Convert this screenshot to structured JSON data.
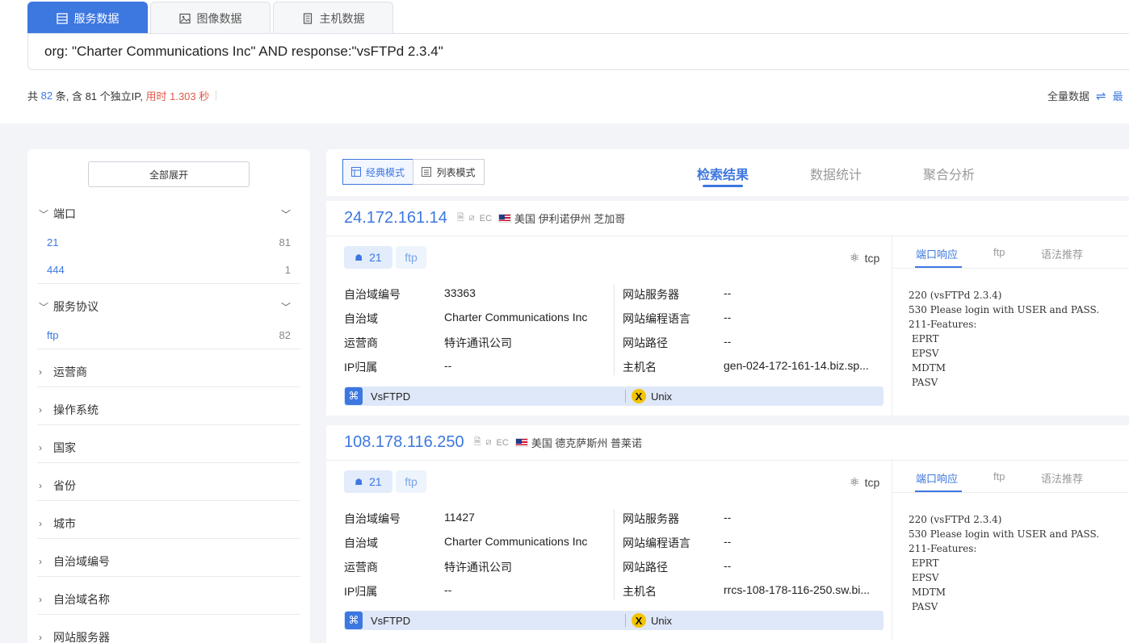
{
  "tabs": [
    {
      "label": "服务数据",
      "icon": "table-icon",
      "active": true
    },
    {
      "label": "图像数据",
      "icon": "image-icon",
      "active": false
    },
    {
      "label": "主机数据",
      "icon": "server-icon",
      "active": false
    }
  ],
  "query": "org: \"Charter Communications Inc\" AND response:\"vsFTPd 2.3.4\"",
  "stats": {
    "prefix": "共",
    "total": "82",
    "mid": "条, 含 81 个独立IP,",
    "time": "用时 1.303 秒"
  },
  "full_data": {
    "label": "全量数据",
    "more": "最"
  },
  "sidebar": {
    "expand_all": "全部展开",
    "groups": [
      {
        "label": "端口",
        "items": [
          {
            "key": "21",
            "count": "81"
          },
          {
            "key": "444",
            "count": "1"
          }
        ]
      },
      {
        "label": "服务协议",
        "items": [
          {
            "key": "ftp",
            "count": "82"
          }
        ]
      }
    ],
    "collapsed": [
      "运营商",
      "操作系统",
      "国家",
      "省份",
      "城市",
      "自治域编号",
      "自治域名称",
      "网站服务器"
    ]
  },
  "view_modes": {
    "classic": "经典模式",
    "list": "列表模式"
  },
  "result_tabs": [
    "检索结果",
    "数据统计",
    "聚合分析"
  ],
  "labels": {
    "asn": "自治域编号",
    "as_name": "自治域",
    "isp": "运营商",
    "ip_owner": "IP归属",
    "web_server": "网站服务器",
    "web_lang": "网站编程语言",
    "web_path": "网站路径",
    "hostname": "主机名",
    "resp_tabs": [
      "端口响应",
      "ftp",
      "语法推荐"
    ],
    "ec": "EC"
  },
  "results": [
    {
      "ip": "24.172.161.14",
      "location": "美国 伊利诺伊州 芝加哥",
      "port": "21",
      "protocol": "ftp",
      "transport": "tcp",
      "asn": "33363",
      "as_name": "Charter Communications Inc",
      "isp": "特许通讯公司",
      "ip_owner": "--",
      "web_server": "--",
      "web_lang": "--",
      "web_path": "--",
      "hostname": "gen-024-172-161-14.biz.sp...",
      "tech": "VsFTPD",
      "os": "Unix",
      "banner": "220 (vsFTPd 2.3.4)\n530 Please login with USER and PASS.\n211-Features:\n EPRT\n EPSV\n MDTM\n PASV"
    },
    {
      "ip": "108.178.116.250",
      "location": "美国 德克萨斯州 普莱诺",
      "port": "21",
      "protocol": "ftp",
      "transport": "tcp",
      "asn": "11427",
      "as_name": "Charter Communications Inc",
      "isp": "特许通讯公司",
      "ip_owner": "--",
      "web_server": "--",
      "web_lang": "--",
      "web_path": "--",
      "hostname": "rrcs-108-178-116-250.sw.bi...",
      "tech": "VsFTPD",
      "os": "Unix",
      "banner": "220 (vsFTPd 2.3.4)\n530 Please login with USER and PASS.\n211-Features:\n EPRT\n EPSV\n MDTM\n PASV"
    }
  ]
}
